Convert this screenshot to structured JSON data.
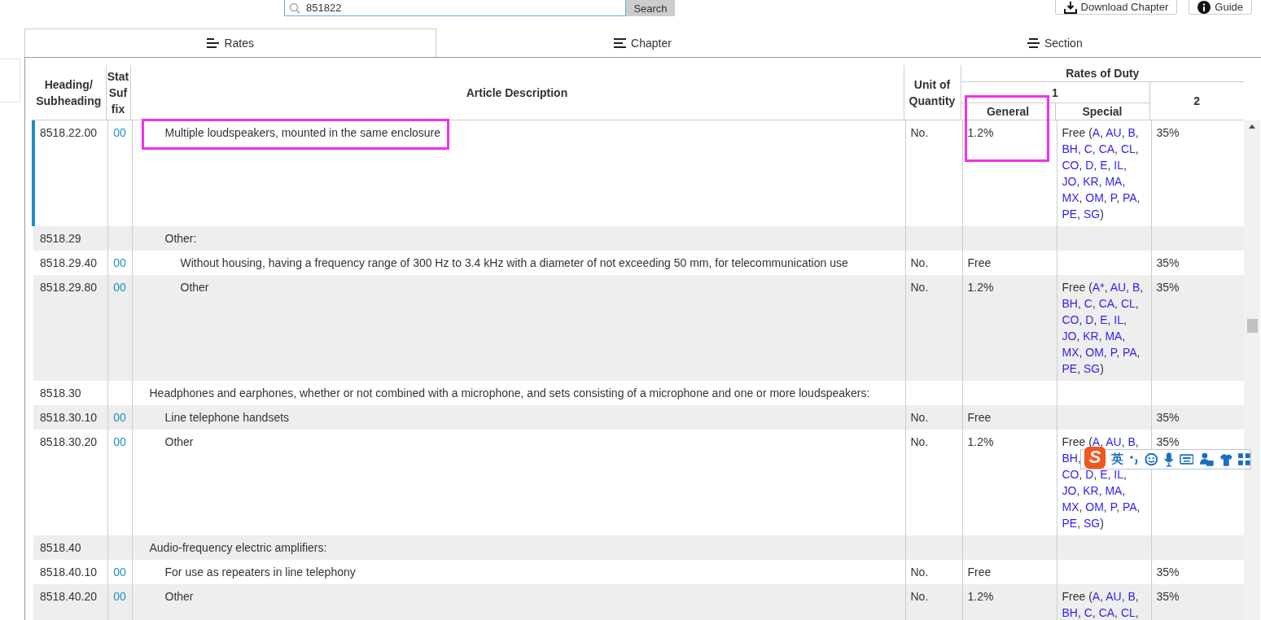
{
  "search": {
    "value": "851822",
    "button": "Search"
  },
  "actions": [
    {
      "label": "Download Chapter"
    },
    {
      "label": "Guide"
    }
  ],
  "tabs": [
    {
      "label": "Rates",
      "selected": true
    },
    {
      "label": "Chapter",
      "selected": false
    },
    {
      "label": "Section",
      "selected": false
    }
  ],
  "table": {
    "columns": {
      "heading": "Heading/ Subheading",
      "stat_suffix": "Stat Suf fix",
      "description": "Article Description",
      "unit": "Unit of Quantity",
      "rates": "Rates of Duty",
      "column_1": "1",
      "general": "General",
      "special": "Special",
      "column_2": "2"
    },
    "rows": [
      {
        "children": [
          {
            "heading": "8518.22.00",
            "suffix": "00",
            "description": "Multiple loudspeakers, mounted in the same enclosure",
            "unit": "No.",
            "general": "1.2%",
            "special": {
              "lead": "Free (",
              "lines": [
                "A, AU, B,",
                "BH, C, CA, CL,",
                "CO, D, E, IL,",
                "JO, KR, MA,",
                "MX, OM, P, PA,",
                "PE, SG"
              ],
              "tail": ")"
            },
            "column_2": "35%",
            "selected": true,
            "description_marked": true,
            "general_marked": true
          },
          {
            "heading": "8518.29",
            "description": "Other:",
            "selected": false,
            "children": [
              {
                "heading": "8518.29.40",
                "suffix": "00",
                "description": "Without housing, having a frequency range of 300 Hz to 3.4 kHz with a diameter of not exceeding 50 mm, for telecommunication use",
                "unit": "No.",
                "general": "Free",
                "column_2": "35%",
                "selected": false
              },
              {
                "heading": "8518.29.80",
                "suffix": "00",
                "description": "Other",
                "unit": "No.",
                "general": "1.2%",
                "special": {
                  "lead": "Free (",
                  "lines": [
                    "A*, AU, B,",
                    "BH, C, CA, CL,",
                    "CO, D, E, IL,",
                    "JO, KR, MA,",
                    "MX, OM, P, PA,",
                    "PE, SG"
                  ],
                  "tail": ")"
                },
                "column_2": "35%",
                "selected": false
              }
            ]
          }
        ]
      },
      {
        "heading": "8518.30",
        "description": "Headphones and earphones, whether or not combined with a microphone, and sets consisting of a microphone and one or more loudspeakers:",
        "selected": false,
        "children": [
          {
            "heading": "8518.30.10",
            "suffix": "00",
            "description": "Line telephone handsets",
            "unit": "No.",
            "general": "Free",
            "column_2": "35%",
            "selected": false
          },
          {
            "heading": "8518.30.20",
            "suffix": "00",
            "description": "Other",
            "unit": "No.",
            "general": "1.2%",
            "special": {
              "lead": "Free (",
              "lines": [
                "A, AU, B,",
                "BH,",
                "CO, D, E, IL,",
                "JO, KR, MA,",
                "MX, OM, P, PA,",
                "PE, SG"
              ],
              "tail": ")"
            },
            "column_2": "35%",
            "selected": false
          }
        ]
      },
      {
        "heading": "8518.40",
        "description": "Audio-frequency electric amplifiers:",
        "selected": false,
        "children": [
          {
            "heading": "8518.40.10",
            "suffix": "00",
            "description": "For use as repeaters in line telephony",
            "unit": "No.",
            "general": "Free",
            "column_2": "35%",
            "selected": false
          },
          {
            "heading": "8518.40.20",
            "suffix": "00",
            "description": "Other",
            "unit": "No.",
            "general": "1.2%",
            "special": {
              "lead": "Free (",
              "lines": [
                "A, AU, B,",
                "BH, C, CA, CL,"
              ]
            },
            "column_2": "35%",
            "selected": false
          }
        ]
      }
    ]
  },
  "ime_toolbar": {
    "logo": "S",
    "mode": "英"
  }
}
